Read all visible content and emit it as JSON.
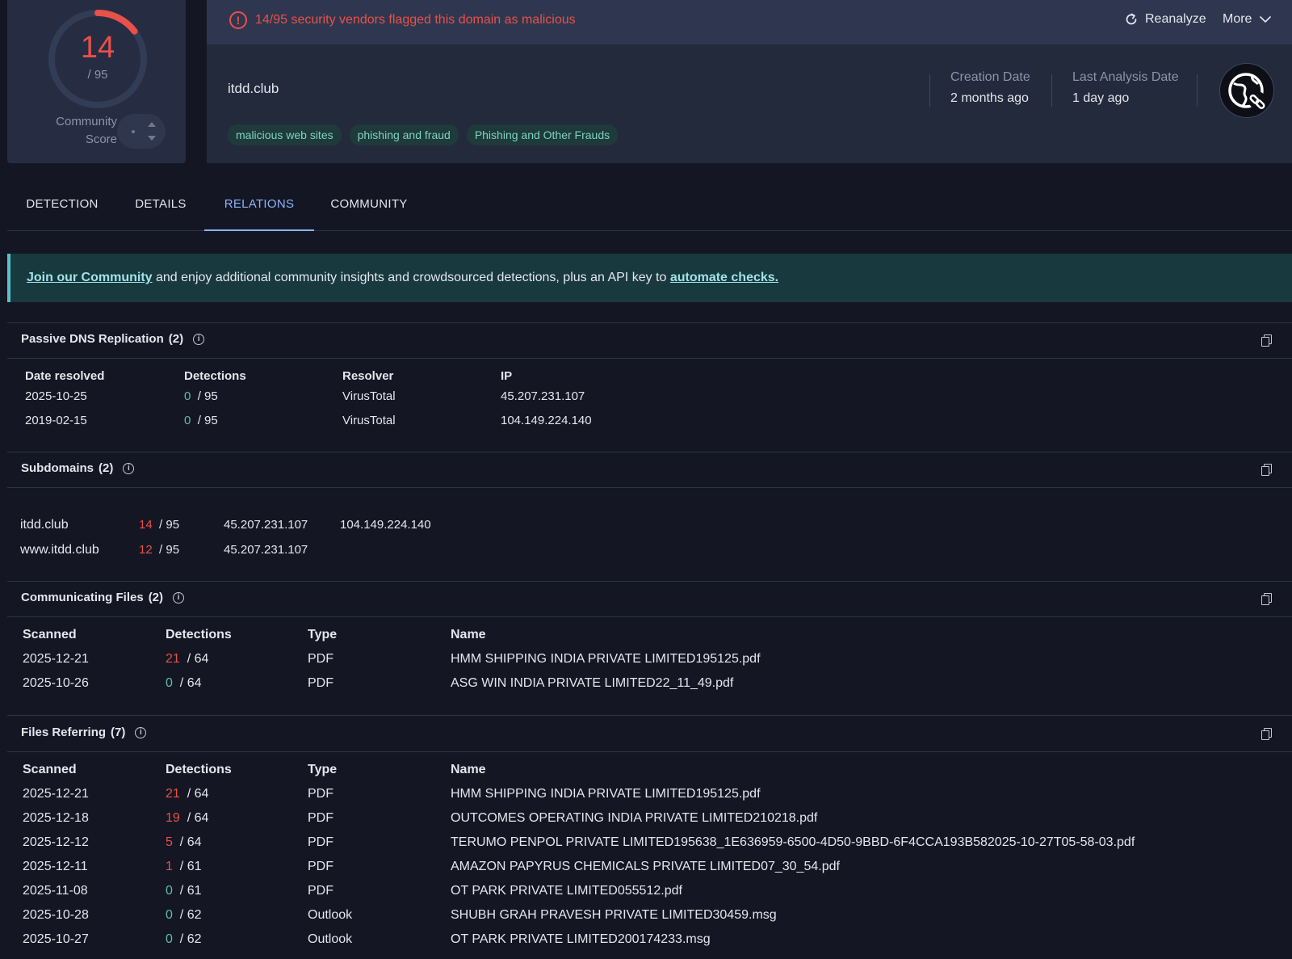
{
  "score": {
    "detected": "14",
    "total": "/ 95",
    "fraction": 0.147,
    "community_label": "Community Score"
  },
  "alert": {
    "text": "14/95 security vendors flagged this domain as malicious",
    "reanalyze": "Reanalyze",
    "more": "More"
  },
  "domain": {
    "name": "itdd.club",
    "tags": [
      "malicious web sites",
      "phishing and fraud",
      "Phishing and Other Frauds"
    ],
    "creation_label": "Creation Date",
    "creation_value": "2 months ago",
    "last_label": "Last Analysis Date",
    "last_value": "1 day ago"
  },
  "tabs": [
    "DETECTION",
    "DETAILS",
    "RELATIONS",
    "COMMUNITY"
  ],
  "active_tab": "RELATIONS",
  "banner": {
    "link1": "Join our Community",
    "middle": " and enjoy additional community insights and crowdsourced detections, plus an API key to ",
    "link2": "automate checks."
  },
  "passive_dns": {
    "title": "Passive DNS Replication",
    "count": "(2)",
    "headers": [
      "Date resolved",
      "Detections",
      "Resolver",
      "IP"
    ],
    "rows": [
      {
        "date": "2025-10-25",
        "det": "0",
        "total": "/ 95",
        "resolver": "VirusTotal",
        "ip": "45.207.231.107"
      },
      {
        "date": "2019-02-15",
        "det": "0",
        "total": "/ 95",
        "resolver": "VirusTotal",
        "ip": "104.149.224.140"
      }
    ]
  },
  "subdomains": {
    "title": "Subdomains",
    "count": "(2)",
    "rows": [
      {
        "domain": "itdd.club",
        "det": "14",
        "total": "/ 95",
        "ip1": "45.207.231.107",
        "ip2": "104.149.224.140"
      },
      {
        "domain": "www.itdd.club",
        "det": "12",
        "total": "/ 95",
        "ip1": "45.207.231.107",
        "ip2": ""
      }
    ]
  },
  "communicating": {
    "title": "Communicating Files",
    "count": "(2)",
    "headers": [
      "Scanned",
      "Detections",
      "Type",
      "Name"
    ],
    "rows": [
      {
        "date": "2025-12-21",
        "det": "21",
        "total": "/ 64",
        "type": "PDF",
        "name": "HMM SHIPPING INDIA PRIVATE LIMITED195125.pdf"
      },
      {
        "date": "2025-10-26",
        "det": "0",
        "total": "/ 64",
        "type": "PDF",
        "name": "ASG WIN INDIA PRIVATE LIMITED22_11_49.pdf"
      }
    ]
  },
  "referring": {
    "title": "Files Referring",
    "count": "(7)",
    "headers": [
      "Scanned",
      "Detections",
      "Type",
      "Name"
    ],
    "rows": [
      {
        "date": "2025-12-21",
        "det": "21",
        "total": "/ 64",
        "type": "PDF",
        "name": "HMM SHIPPING INDIA PRIVATE LIMITED195125.pdf"
      },
      {
        "date": "2025-12-18",
        "det": "19",
        "total": "/ 64",
        "type": "PDF",
        "name": "OUTCOMES OPERATING INDIA PRIVATE LIMITED210218.pdf"
      },
      {
        "date": "2025-12-12",
        "det": "5",
        "total": "/ 64",
        "type": "PDF",
        "name": "TERUMO PENPOL PRIVATE LIMITED195638_1E636959-6500-4D50-9BBD-6F4CCA193B582025-10-27T05-58-03.pdf"
      },
      {
        "date": "2025-12-11",
        "det": "1",
        "total": "/ 61",
        "type": "PDF",
        "name": "AMAZON PAPYRUS CHEMICALS PRIVATE LIMITED07_30_54.pdf"
      },
      {
        "date": "2025-11-08",
        "det": "0",
        "total": "/ 61",
        "type": "PDF",
        "name": "OT PARK PRIVATE LIMITED055512.pdf"
      },
      {
        "date": "2025-10-28",
        "det": "0",
        "total": "/ 62",
        "type": "Outlook",
        "name": "SHUBH GRAH PRAVESH PRIVATE LIMITED30459.msg"
      },
      {
        "date": "2025-10-27",
        "det": "0",
        "total": "/ 62",
        "type": "Outlook",
        "name": "OT PARK PRIVATE LIMITED200174233.msg"
      }
    ]
  },
  "colors": {
    "malicious": "#e8504a",
    "clean": "#5bc0a8",
    "accent": "#8ab4f8"
  }
}
